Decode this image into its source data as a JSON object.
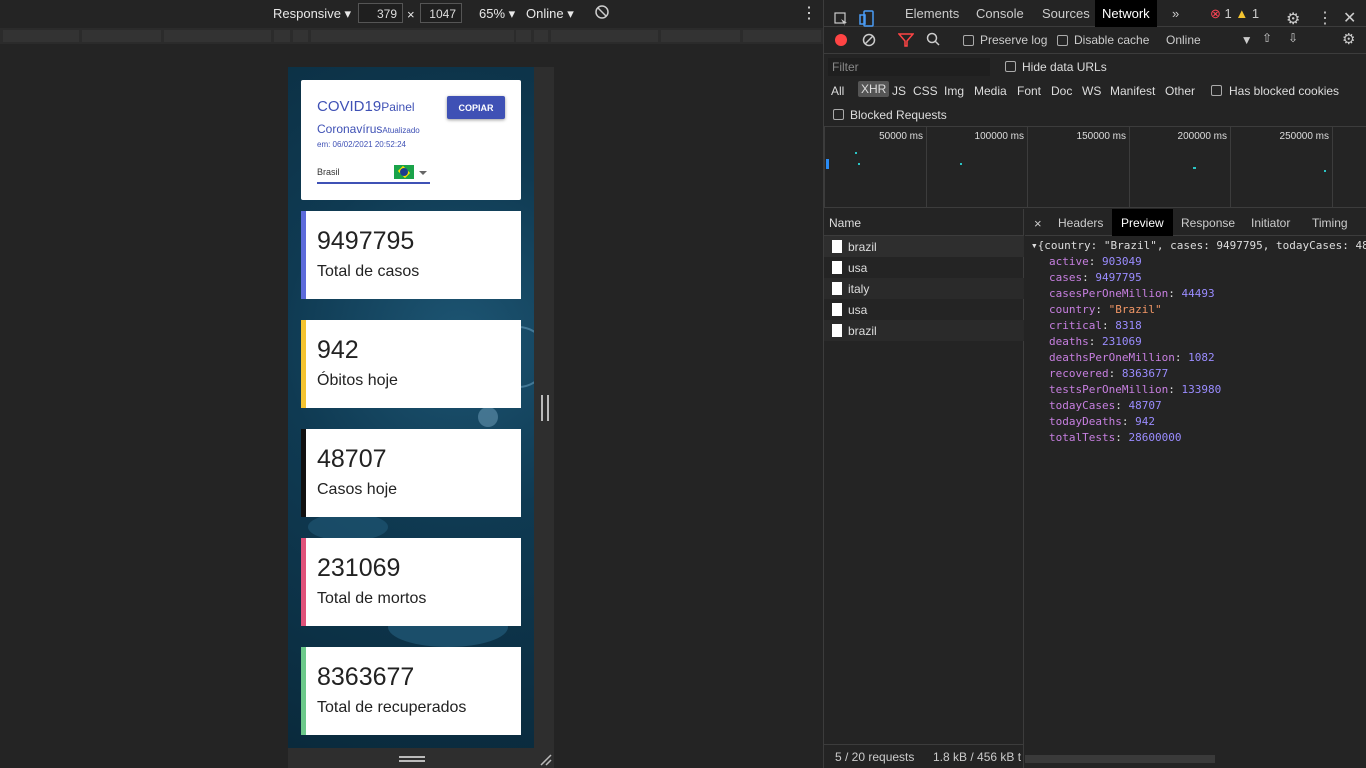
{
  "device_toolbar": {
    "mode": "Responsive",
    "width": "379",
    "times": "×",
    "height": "1047",
    "zoom": "65%",
    "throttle": "Online"
  },
  "app": {
    "title_main": "COVID19",
    "title_sub": "Painel",
    "subtitle_main": "Coronavírus",
    "subtitle_sub": "Atualizado",
    "updated": "em: 06/02/2021 20:52:24",
    "copy_label": "COPIAR",
    "country": "Brasil",
    "stats": [
      {
        "value": "9497795",
        "label": "Total de casos",
        "color": "#5c6bdb"
      },
      {
        "value": "942",
        "label": "Óbitos hoje",
        "color": "#f5c430"
      },
      {
        "value": "48707",
        "label": "Casos hoje",
        "color": "#111111"
      },
      {
        "value": "231069",
        "label": "Total de mortos",
        "color": "#e0527a"
      },
      {
        "value": "8363677",
        "label": "Total de recuperados",
        "color": "#6cc98a"
      }
    ]
  },
  "devtools": {
    "tabs": [
      "Elements",
      "Console",
      "Sources",
      "Network"
    ],
    "active_tab": "Network",
    "errors": "1",
    "warnings": "1",
    "preserve_log": "Preserve log",
    "disable_cache": "Disable cache",
    "online": "Online",
    "filter_placeholder": "Filter",
    "hide_data_urls": "Hide data URLs",
    "types": [
      "All",
      "XHR",
      "JS",
      "CSS",
      "Img",
      "Media",
      "Font",
      "Doc",
      "WS",
      "Manifest",
      "Other"
    ],
    "has_blocked_cookies": "Has blocked cookies",
    "blocked_requests": "Blocked Requests",
    "timeline_ticks": [
      "50000 ms",
      "100000 ms",
      "150000 ms",
      "200000 ms",
      "250000 ms"
    ],
    "name_header": "Name",
    "requests": [
      "brazil",
      "usa",
      "italy",
      "usa",
      "brazil"
    ],
    "detail_tabs": [
      "Headers",
      "Preview",
      "Response",
      "Initiator",
      "Timing"
    ],
    "active_detail_tab": "Preview",
    "preview_summary": "{country: \"Brazil\", cases: 9497795, todayCases: 48",
    "preview_fields": [
      {
        "key": "active",
        "value": "903049",
        "type": "num"
      },
      {
        "key": "cases",
        "value": "9497795",
        "type": "num"
      },
      {
        "key": "casesPerOneMillion",
        "value": "44493",
        "type": "num"
      },
      {
        "key": "country",
        "value": "\"Brazil\"",
        "type": "str"
      },
      {
        "key": "critical",
        "value": "8318",
        "type": "num"
      },
      {
        "key": "deaths",
        "value": "231069",
        "type": "num"
      },
      {
        "key": "deathsPerOneMillion",
        "value": "1082",
        "type": "num"
      },
      {
        "key": "recovered",
        "value": "8363677",
        "type": "num"
      },
      {
        "key": "testsPerOneMillion",
        "value": "133980",
        "type": "num"
      },
      {
        "key": "todayCases",
        "value": "48707",
        "type": "num"
      },
      {
        "key": "todayDeaths",
        "value": "942",
        "type": "num"
      },
      {
        "key": "totalTests",
        "value": "28600000",
        "type": "num"
      }
    ],
    "status_requests": "5 / 20 requests",
    "status_size": "1.8 kB / 456 kB t"
  }
}
